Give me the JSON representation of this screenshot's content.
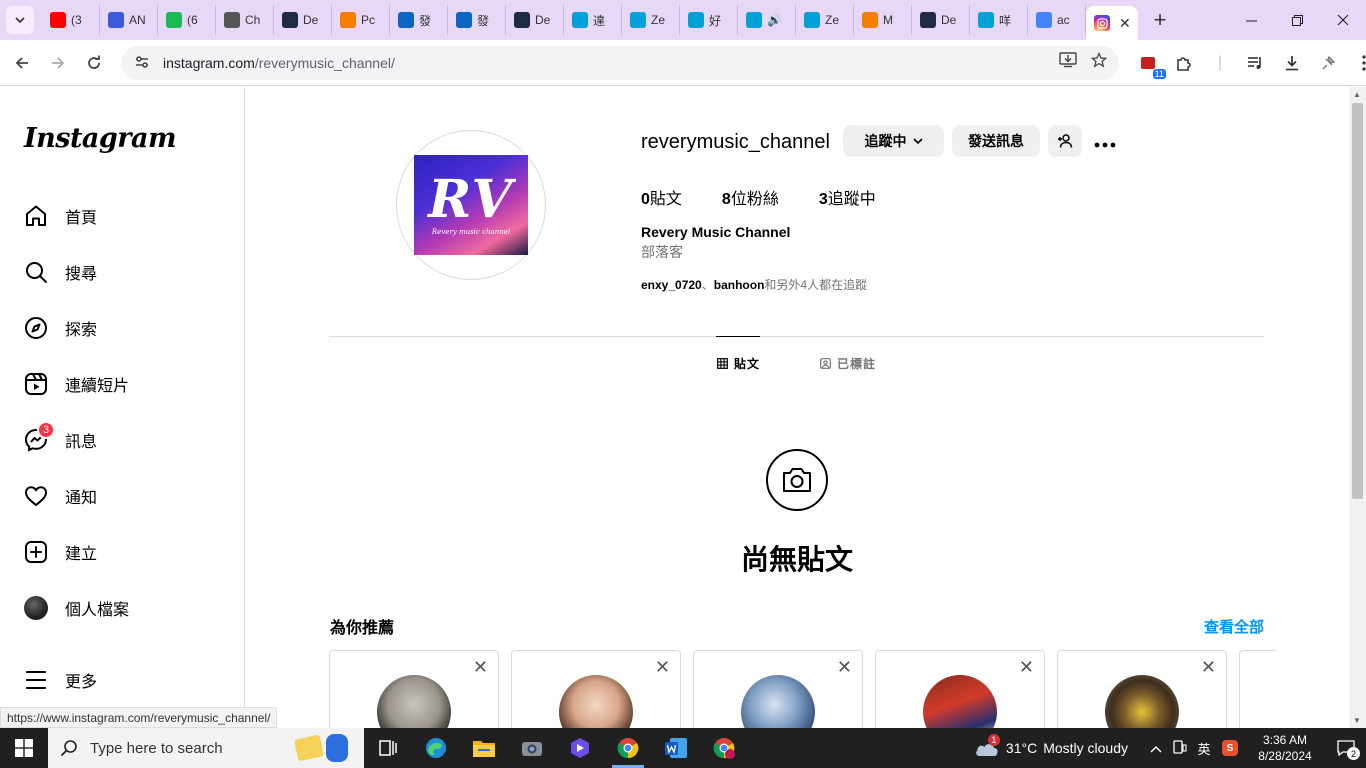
{
  "browser": {
    "tabs": [
      {
        "icon": "youtube-icon",
        "label": "(3",
        "color": "#ff0000"
      },
      {
        "icon": "app-icon",
        "label": "AN",
        "color": "#3b5bdb"
      },
      {
        "icon": "counter-icon",
        "label": "(6",
        "color": "#1db954"
      },
      {
        "icon": "chatgpt-icon",
        "label": "Ch",
        "color": "#555555"
      },
      {
        "icon": "hexagon-icon",
        "label": "De",
        "color": "#1f2a44"
      },
      {
        "icon": "blogger-icon",
        "label": "Pc",
        "color": "#f57d00"
      },
      {
        "icon": "linkedin-icon",
        "label": "發",
        "color": "#0a66c2"
      },
      {
        "icon": "linkedin-icon",
        "label": "發",
        "color": "#0a66c2"
      },
      {
        "icon": "hexagon-icon",
        "label": "De",
        "color": "#1f2a44"
      },
      {
        "icon": "bilibili-icon",
        "label": "達",
        "color": "#00a1d6"
      },
      {
        "icon": "bilibili-icon",
        "label": "Ze",
        "color": "#00a1d6"
      },
      {
        "icon": "bilibili-icon",
        "label": "好",
        "color": "#00a1d6"
      },
      {
        "icon": "bilibili-icon",
        "label": "🔊",
        "color": "#00a1d6"
      },
      {
        "icon": "bilibili-icon",
        "label": "Ze",
        "color": "#00a1d6"
      },
      {
        "icon": "blogger-icon",
        "label": "M",
        "color": "#f57d00"
      },
      {
        "icon": "hexagon-icon",
        "label": "De",
        "color": "#1f2a44"
      },
      {
        "icon": "bilibili-icon",
        "label": "咩",
        "color": "#00a1d6"
      },
      {
        "icon": "google-icon",
        "label": "ac",
        "color": "#4285f4"
      }
    ],
    "active_tab": {
      "icon": "instagram-icon",
      "close": "✕"
    },
    "url_host": "instagram.com",
    "url_path": "/reverymusic_channel/",
    "extension_badge": "11",
    "status_url": "https://www.instagram.com/reverymusic_channel/"
  },
  "sidebar": {
    "logo": "Instagram",
    "items": [
      {
        "label": "首頁",
        "icon": "home-icon"
      },
      {
        "label": "搜尋",
        "icon": "search-icon"
      },
      {
        "label": "探索",
        "icon": "explore-icon"
      },
      {
        "label": "連續短片",
        "icon": "reels-icon"
      },
      {
        "label": "訊息",
        "icon": "messenger-icon",
        "badge": "3"
      },
      {
        "label": "通知",
        "icon": "heart-icon"
      },
      {
        "label": "建立",
        "icon": "create-icon"
      },
      {
        "label": "個人檔案",
        "icon": "profile-avatar"
      },
      {
        "label": "更多",
        "icon": "menu-icon"
      }
    ]
  },
  "profile": {
    "username": "reverymusic_channel",
    "following_button": "追蹤中",
    "message_button": "發送訊息",
    "stats": {
      "posts": "0",
      "posts_label": "貼文",
      "followers": "8",
      "followers_label": "位粉絲",
      "following": "3",
      "following_label": "追蹤中"
    },
    "full_name": "Revery Music Channel",
    "category": "部落客",
    "followed_by_1": "enxy_0720",
    "separator": "、",
    "followed_by_2": "banhoon",
    "followed_by_suffix": "和另外4人都在追蹤",
    "pic_text": "RV",
    "pic_subtext": "Revery music channel"
  },
  "tabs": {
    "posts": "貼文",
    "tagged": "已標註"
  },
  "empty": {
    "title": "尚無貼文"
  },
  "suggestions": {
    "title": "為你推薦",
    "see_all": "查看全部",
    "cards": [
      {
        "close": "✕"
      },
      {
        "close": "✕"
      },
      {
        "close": "✕"
      },
      {
        "close": "✕"
      },
      {
        "close": "✕"
      }
    ]
  },
  "taskbar": {
    "search_placeholder": "Type here to search",
    "weather_temp": "31°C",
    "weather_text": "Mostly cloudy",
    "ime": "英",
    "time": "3:36 AM",
    "date": "8/28/2024",
    "notifications": "2",
    "weather_alert": "1"
  }
}
